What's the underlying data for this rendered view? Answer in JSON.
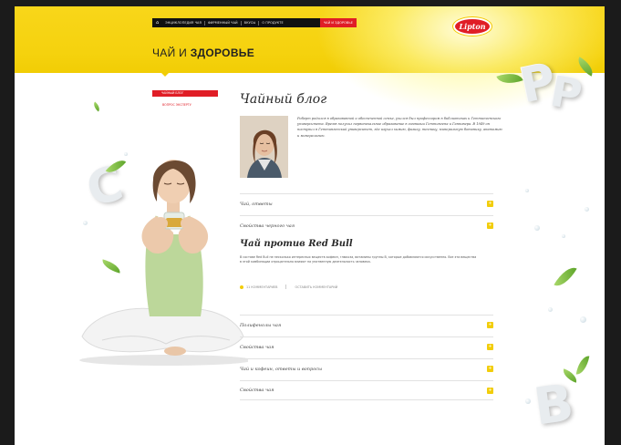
{
  "topnav": {
    "home_icon": "home-icon",
    "items": [
      "ЭНЦИКЛОПЕДИЯ ЧАЯ",
      "ФИРМЕННЫЙ ЧАЙ",
      "ВКУСЫ",
      "О ПРОДУКТЕ",
      "ЧАЙ И ЗДОРОВЬЕ"
    ],
    "active_index": 4
  },
  "brand": {
    "logo_text": "Lipton",
    "accent": "#e01d26",
    "yellow": "#f4d00f"
  },
  "section": {
    "title_light": "ЧАЙ И",
    "title_bold": "ЗДОРОВЬЕ"
  },
  "subnav": {
    "active_label": "ЧАЙНЫЙ БЛОГ",
    "link_label": "ВОПРОС ЭКСПЕРТУ"
  },
  "blog": {
    "title": "Чайный блог",
    "author_text": "Роберт родился в образованной и обеспеченной семье, учился был профессором в библиотеках и Геттингенского университета. Время получил первоначальное образование в гимназии Геттингена и Ганновера. В 1949 он поступил в Геттингенский университет, где изучал химию, физику, технику, минеральную ботанику, анатомию и минералогию."
  },
  "accordion_top": [
    {
      "label": "Чай, ответы",
      "toggle": "+"
    },
    {
      "label": "Свойства черного чая",
      "toggle": "+"
    }
  ],
  "article": {
    "title": "Чай против Red Bull",
    "text": "В составе Red Bull не несколько интересных веществ кофеин, глюкоза, витамины группы B, которые добавляются искусственно. Все эти вещества в этой комбинации отрицательно влияют на умственную деятельность человека.",
    "meta_comments": "11 КОММЕНТАРИЕВ",
    "meta_add": "ОСТАВИТЬ КОММЕНТАРИЙ"
  },
  "accordion_bottom": [
    {
      "label": "Полифенолы чая",
      "toggle": "+"
    },
    {
      "label": "Свойства чая",
      "toggle": "+"
    },
    {
      "label": "Чай и кофеин, ответы и вопросы",
      "toggle": "+"
    },
    {
      "label": "Свойства чая",
      "toggle": "+"
    }
  ]
}
